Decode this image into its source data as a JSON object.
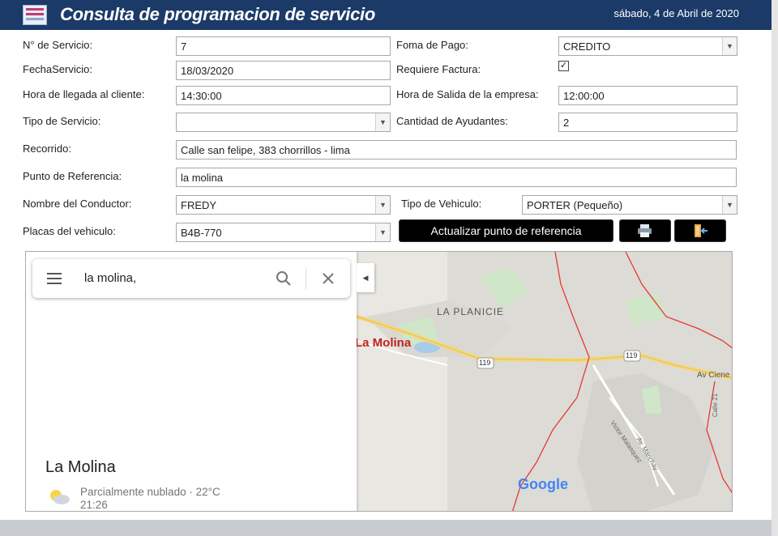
{
  "window": {
    "title": "Consulta de programacion de servicio",
    "date": "sábado, 4 de Abril de 2020"
  },
  "form": {
    "servicio_label": "N° de Servicio:",
    "servicio_value": "7",
    "forma_pago_label": "Foma de Pago:",
    "forma_pago_value": "CREDITO",
    "fecha_label": "FechaServicio:",
    "fecha_value": "18/03/2020",
    "factura_label": "Requiere Factura:",
    "factura_checked": "✓",
    "hora_llegada_label": "Hora de llegada al cliente:",
    "hora_llegada_value": "14:30:00",
    "hora_salida_label": "Hora de Salida de la empresa:",
    "hora_salida_value": "12:00:00",
    "tipo_servicio_label": "Tipo de Servicio:",
    "tipo_servicio_value": "",
    "ayudantes_label": "Cantidad de Ayudantes:",
    "ayudantes_value": "2",
    "recorrido_label": "Recorrido:",
    "recorrido_value": "Calle san felipe, 383 chorrillos - lima",
    "referencia_label": "Punto de Referencia:",
    "referencia_value": "la molina",
    "conductor_label": "Nombre del Conductor:",
    "conductor_value": "FREDY",
    "vehiculo_label": "Tipo de Vehiculo:",
    "vehiculo_value": "PORTER (Pequeño)",
    "placas_label": "Placas del vehiculo:",
    "placas_value": "B4B-770"
  },
  "buttons": {
    "actualizar_label": "Actualizar punto de referencia",
    "print_icon": "printer-icon",
    "exit_icon": "exit-door-icon"
  },
  "map": {
    "search_query": "la molina,",
    "place_name": "La Molina",
    "weather": "Parcialmente nublado · 22°C",
    "time": "21:26",
    "label_planicie": "LA PLANICIE",
    "label_molina": "La Molina",
    "road_119": "119",
    "label_av_ciene": "Av Ciene",
    "label_calle21": "Calle 21",
    "label_victor": "Victor Malasquez",
    "label_manchay": "Av. Manchay",
    "google_logo": "Google"
  },
  "colors": {
    "titlebar": "#1b3a68",
    "button_dark": "#000000",
    "map_boundary": "#e53935",
    "road_yellow": "#f6d77a"
  }
}
